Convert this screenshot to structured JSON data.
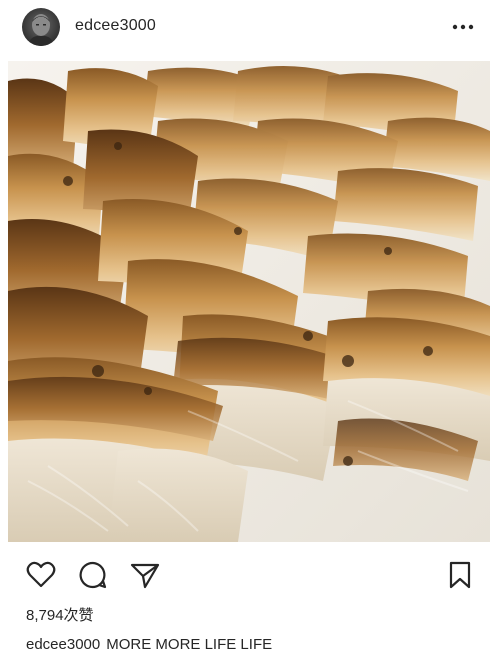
{
  "post": {
    "username": "edcee3000",
    "likes": "8,794次赞",
    "caption_user": "edcee3000",
    "caption_text": "MORE MORE LIFE LIFE"
  },
  "icons": {
    "header_more": "more-options-icon",
    "like": "heart-icon",
    "comment": "comment-icon",
    "share": "paper-plane-icon",
    "save": "bookmark-icon"
  },
  "colors": {
    "text": "#262626",
    "background": "#ffffff",
    "icon": "#262626"
  }
}
